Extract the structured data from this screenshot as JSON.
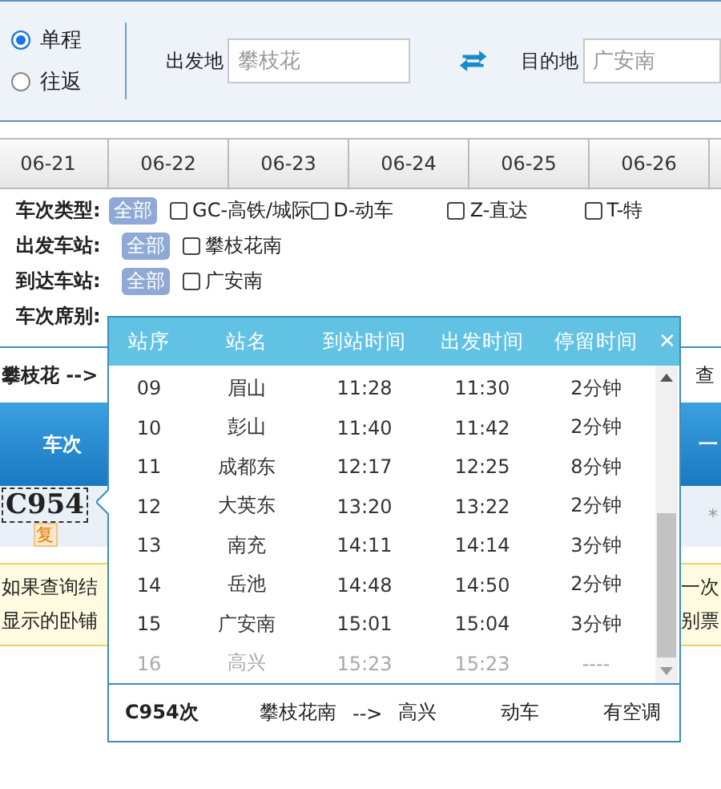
{
  "trip_type": [
    {
      "label": "单程",
      "selected": true
    },
    {
      "label": "往返",
      "selected": false
    }
  ],
  "from": {
    "label": "出发地",
    "placeholder": "攀枝花"
  },
  "to": {
    "label": "目的地",
    "placeholder": "广安南"
  },
  "date_tabs": [
    {
      "label": "06-21",
      "selected": false
    },
    {
      "label": "06-22",
      "selected": false
    },
    {
      "label": "06-23",
      "selected": false
    },
    {
      "label": "06-24",
      "selected": false
    },
    {
      "label": "06-25",
      "selected": false
    },
    {
      "label": "06-26",
      "selected": false
    }
  ],
  "filters": [
    {
      "label": "车次类型:",
      "all": "全部",
      "options": [
        {
          "label": "GC-高铁/城际",
          "checked": false
        },
        {
          "label": "D-动车",
          "checked": false
        },
        {
          "label": "Z-直达",
          "checked": false
        },
        {
          "label": "T-特",
          "checked": false
        }
      ]
    },
    {
      "label": "出发车站:",
      "all": "全部",
      "options": [
        {
          "label": "攀枝花南",
          "checked": false
        }
      ]
    },
    {
      "label": "到达车站:",
      "all": "全部",
      "options": [
        {
          "label": "广安南",
          "checked": false
        }
      ]
    },
    {
      "label": "车次席别:"
    }
  ],
  "route": {
    "text": "攀枝花 -->",
    "query": "查"
  },
  "results": {
    "header": "车次",
    "header_right": "一",
    "train": "C954",
    "badge": "复",
    "seat": "*"
  },
  "notice": {
    "left": [
      "如果查询结",
      "显示的卧铺"
    ],
    "right": [
      "一次",
      "别票"
    ]
  },
  "popup": {
    "columns": [
      "站序",
      "站名",
      "到站时间",
      "出发时间",
      "停留时间"
    ],
    "close": "✕",
    "rows": [
      {
        "no": "09",
        "station": "眉山",
        "arrive": "11:28",
        "depart": "11:30",
        "stop": "2分钟",
        "passed": false
      },
      {
        "no": "10",
        "station": "彭山",
        "arrive": "11:40",
        "depart": "11:42",
        "stop": "2分钟",
        "passed": false
      },
      {
        "no": "11",
        "station": "成都东",
        "arrive": "12:17",
        "depart": "12:25",
        "stop": "8分钟",
        "passed": false
      },
      {
        "no": "12",
        "station": "大英东",
        "arrive": "13:20",
        "depart": "13:22",
        "stop": "2分钟",
        "passed": false
      },
      {
        "no": "13",
        "station": "南充",
        "arrive": "14:11",
        "depart": "14:14",
        "stop": "3分钟",
        "passed": false
      },
      {
        "no": "14",
        "station": "岳池",
        "arrive": "14:48",
        "depart": "14:50",
        "stop": "2分钟",
        "passed": false
      },
      {
        "no": "15",
        "station": "广安南",
        "arrive": "15:01",
        "depart": "15:04",
        "stop": "3分钟",
        "passed": false
      },
      {
        "no": "16",
        "station": "高兴",
        "arrive": "15:23",
        "depart": "15:23",
        "stop": "----",
        "passed": true
      }
    ],
    "footer": {
      "train": "C954次",
      "from": "攀枝花南",
      "arrow": "-->",
      "to": "高兴",
      "type": "动车",
      "ac": "有空调"
    }
  }
}
